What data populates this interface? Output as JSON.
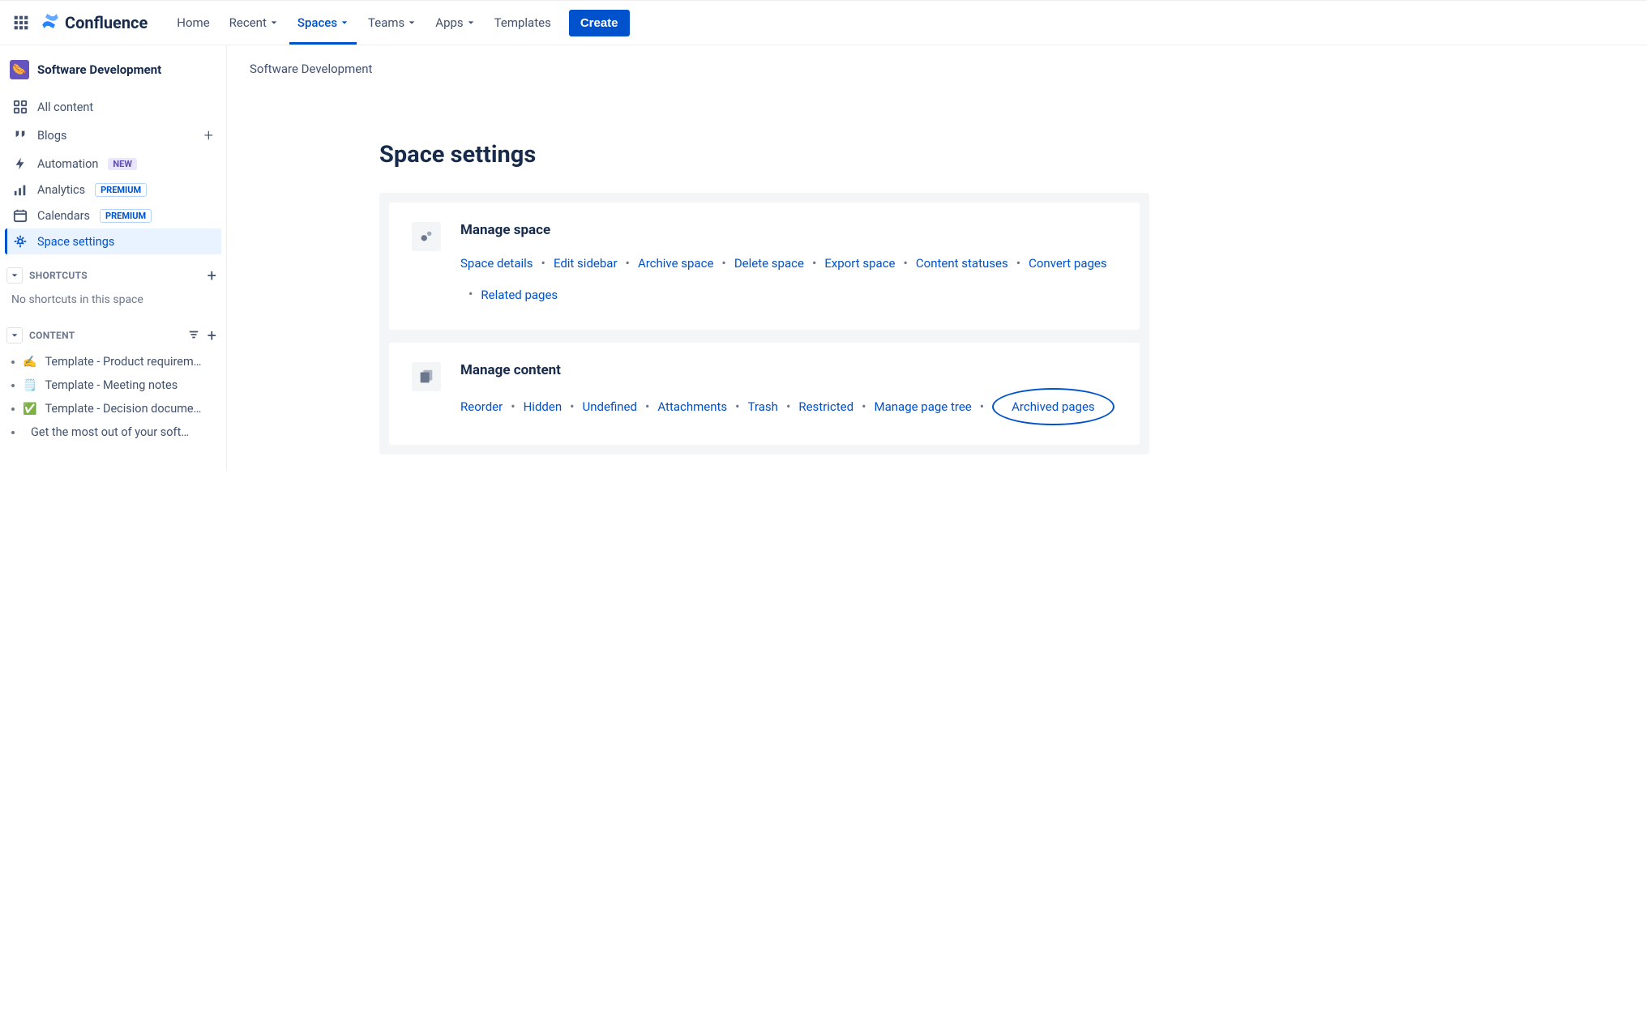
{
  "app": {
    "name": "Confluence"
  },
  "nav": {
    "home": "Home",
    "recent": "Recent",
    "spaces": "Spaces",
    "teams": "Teams",
    "apps": "Apps",
    "templates": "Templates",
    "create": "Create"
  },
  "sidebar": {
    "space_name": "Software Development",
    "items": {
      "all_content": "All content",
      "blogs": "Blogs",
      "automation": "Automation",
      "automation_badge": "NEW",
      "analytics": "Analytics",
      "analytics_badge": "PREMIUM",
      "calendars": "Calendars",
      "calendars_badge": "PREMIUM",
      "space_settings": "Space settings"
    },
    "shortcuts": {
      "label": "SHORTCUTS",
      "empty": "No shortcuts in this space"
    },
    "content": {
      "label": "CONTENT",
      "items": [
        {
          "emoji": "✍️",
          "txt": "Template - Product requireme..."
        },
        {
          "emoji": "🗒️",
          "txt": "Template - Meeting notes"
        },
        {
          "emoji": "✅",
          "txt": "Template - Decision documen..."
        },
        {
          "emoji": "",
          "txt": "Get the most out of your software..."
        }
      ]
    }
  },
  "main": {
    "breadcrumb": "Software Development",
    "title": "Space settings",
    "manage_space": {
      "title": "Manage space",
      "links": [
        "Space details",
        "Edit sidebar",
        "Archive space",
        "Delete space",
        "Export space",
        "Content statuses",
        "Convert pages",
        "Related pages"
      ]
    },
    "manage_content": {
      "title": "Manage content",
      "links": [
        "Reorder",
        "Hidden",
        "Undefined",
        "Attachments",
        "Trash",
        "Restricted",
        "Manage page tree",
        "Archived pages"
      ]
    }
  }
}
